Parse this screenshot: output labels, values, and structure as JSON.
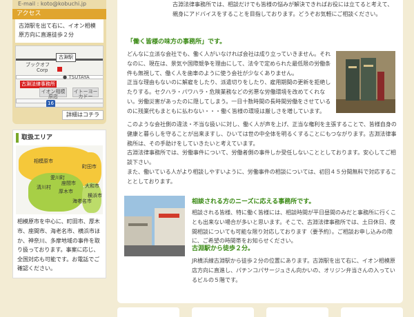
{
  "sidebar": {
    "email_line": "E-mail : koto@kobuchi.jp",
    "access": {
      "header": "アクセス",
      "text": "古淵駅を出て右に、イオン相模原方向に直進徒歩２分",
      "map": {
        "labels": [
          "ブックオフ",
          "Corp",
          "TSUTAYA",
          "イオン相模原店",
          "イトーヨーカドー",
          "16"
        ],
        "station": "古淵駅",
        "office": "古淵法律事務所"
      },
      "detail_button": "詳細はコチラ"
    },
    "area": {
      "header": "取扱エリア",
      "towns": [
        "相模原市",
        "町田市",
        "愛川町",
        "清川村",
        "厚木市",
        "大和市",
        "海老名市",
        "横浜市",
        "座間市"
      ],
      "text": "相模原市を中心に、町田市、厚木市、座間市、海老名市、横浜市ほか、神奈川、多摩地域の事件を取り扱っております。事案に応じ、全国対応も可能です。お電話でご確認ください。"
    }
  },
  "main": {
    "intro": "古淵法律事務所では、相談だけでも皆様の悩みが解決できればお役には立てると考えて、親身にアドバイスをすることを目指しております。どうぞお気軽にご相談ください。",
    "sec1": {
      "heading": "「働く皆様の味方の事務所」です。",
      "p1": "どんなに立派な会社でも、働く人がいなければ会社は成り立っていきません。それなのに、現在は、景気や国際競争を理由にして、法令で定められた最低限の労働条件も無視して、働く人を歯車のように使う会社が少なくありません。",
      "p2": "正当な理由もないのに解雇をしたり、派遣切りをしたり、雇用期間の更新を拒絶したりする。セクハラ・パワハラ・危険業務などの劣悪な労働環境を改めてくれない。労働災害があったのに隠してしまう。一日十数時間の長時間労働をさせているのに残業代もまともに払わない・・・働く皆様の環境は厳しさを増しています。",
      "p3": "このような会社側の違法・不当な扱いに対し、働く人が声を上げ、正当な権利を主張することで、皆様自身の健康と暮らしを守ることが出来ますし、ひいては世の中全体を明るくすることにもつながります。古淵法律事務所は、その手助けをしていきたいと考えています。",
      "p4": "古淵法律事務所では、労働事件について、労働者側の事件しか受任しないこととしております。安心してご相談下さい。",
      "p5": "また、働いている人がより相談しやすいように、労働事件の相談については、初回４５分間無料で対応することとしております。"
    },
    "sec2": {
      "heading": "相談される方のニーズに応える事務所です。",
      "p1": "相談される皆様、特に働く皆様には、相談時間が平日昼間のみだと事務所に行くことも出来ない場合が多いと思います。そこで、古淵法律事務所では、土日休日、夜間相談についても可能な限り対応しております（要予約）。ご相談お申し込みの際に、ご希望の時間帯をお知らせください。"
    },
    "sec3": {
      "heading": "古淵駅から徒歩２分。",
      "p1": "JR横浜線古淵駅から徒歩２分の位置にあります。古淵駅を出て右に、イオン相模原店方向に直進し、パチンコパサージュさん向かいの、オリジン弁当さんの入っているビルの５階です。"
    }
  },
  "colors": {
    "accent_green": "#3a8a14",
    "access_orange": "#e0a52e",
    "office_red": "#d81e1e",
    "page_bg": "#f3ecd4"
  }
}
